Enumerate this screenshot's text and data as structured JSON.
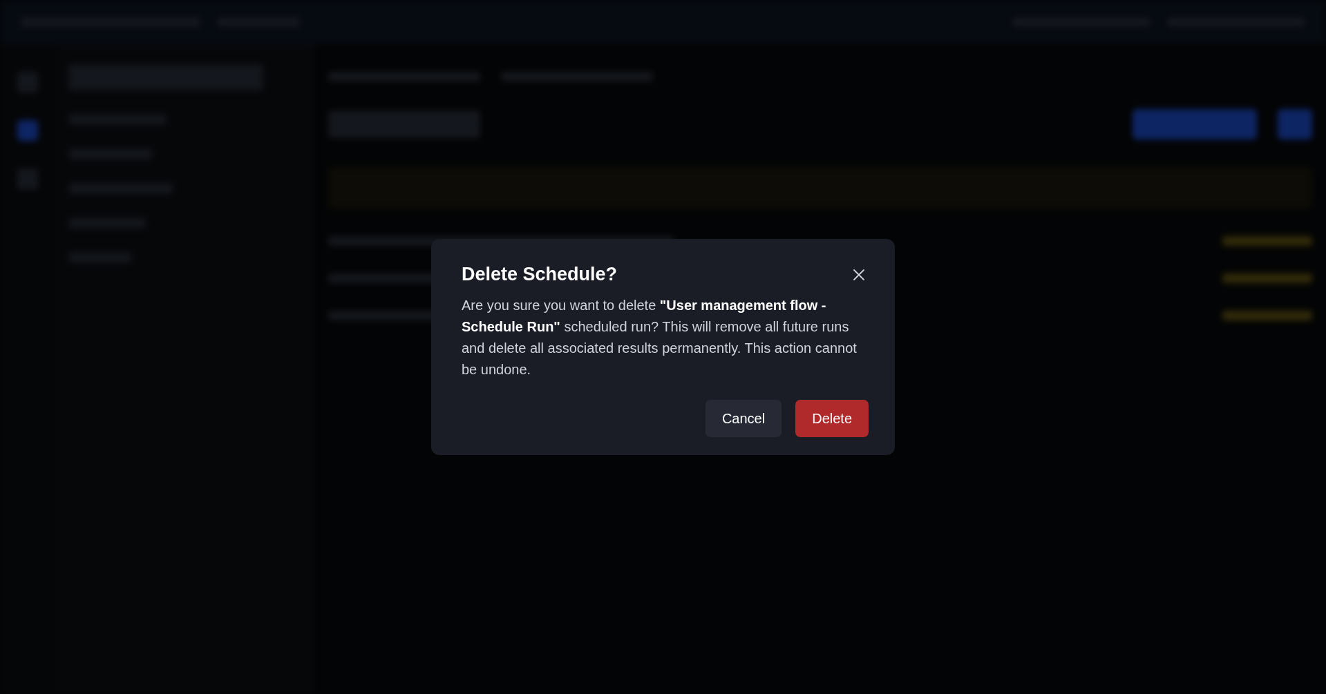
{
  "dialog": {
    "title": "Delete Schedule?",
    "message": "Are you sure you want to delete **\"User management flow - Schedule Run\"** scheduled run? This will remove all future runs and delete all associated results permanently. This action cannot be undone.",
    "buttons": [
      {
        "label": "Cancel",
        "kind": "secondary"
      },
      {
        "label": "Delete",
        "kind": "danger"
      }
    ]
  }
}
